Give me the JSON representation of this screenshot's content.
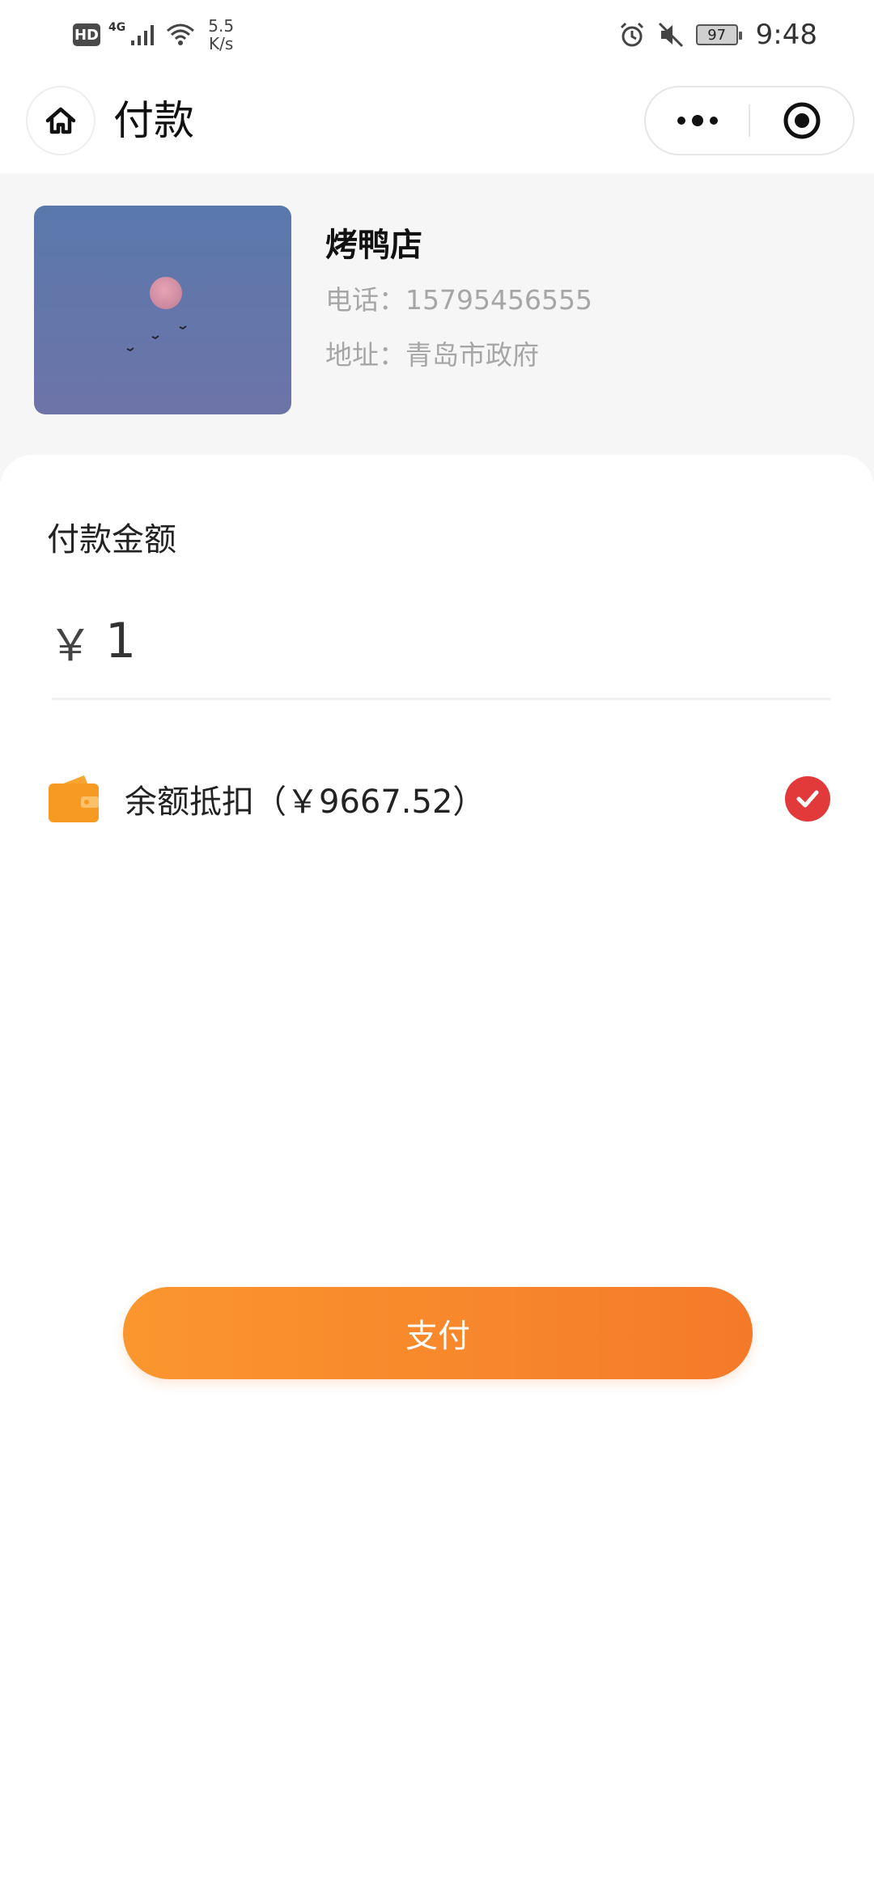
{
  "status_bar": {
    "hd": "HD",
    "network": "4G",
    "speed_top": "5.5",
    "speed_bottom": "K/s",
    "battery": "97",
    "time": "9:48"
  },
  "title_bar": {
    "title": "付款"
  },
  "shop": {
    "name": "烤鸭店",
    "phone": "电话：15795456555",
    "address": "地址：青岛市政府"
  },
  "payment": {
    "amount_label": "付款金额",
    "currency": "￥",
    "amount_value": "1",
    "balance_text": "余额抵扣（￥9667.52）",
    "balance_checked": true
  },
  "pay_button": {
    "label": "支付"
  },
  "colors": {
    "accent_orange": "#f7862c",
    "check_red": "#e23a3a",
    "muted_text": "#a6a6a6",
    "header_bg": "#f6f6f7"
  },
  "icons": {
    "home": "home-icon",
    "more": "more-dots-icon",
    "close": "target-icon",
    "wallet": "wallet-icon",
    "check": "check-icon"
  }
}
